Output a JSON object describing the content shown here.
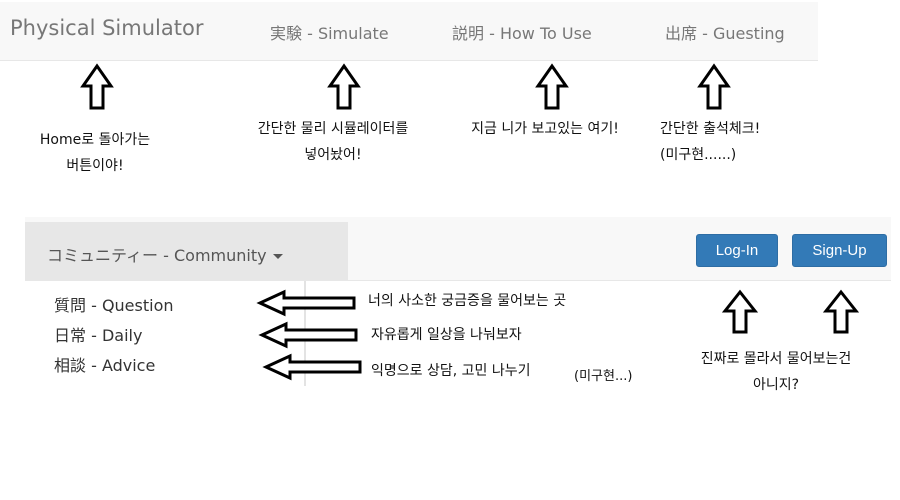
{
  "top_nav": {
    "brand": "Physical Simulator",
    "links": [
      {
        "label": "実験 - Simulate"
      },
      {
        "label": "説明 - How To Use"
      },
      {
        "label": "出席 - Guesting"
      }
    ]
  },
  "annotations_top": {
    "home": [
      "Home로 돌아가는",
      "버튼이야!"
    ],
    "simulate": [
      "간단한 물리 시뮬레이터를",
      "넣어놨어!"
    ],
    "how_to_use": [
      "지금 니가 보고있는 여기!"
    ],
    "guesting": [
      "간단한 출석체크!",
      "(미구현......)"
    ]
  },
  "bottom_nav": {
    "dropdown_label": "コミュニティー - Community",
    "login_label": "Log-In",
    "signup_label": "Sign-Up",
    "menu_items": [
      {
        "label": "質問 - Question"
      },
      {
        "label": "日常 - Daily"
      },
      {
        "label": "相談 - Advice"
      }
    ]
  },
  "annotations_bottom": {
    "question": "너의 사소한 궁금증을 물어보는 곳",
    "daily": "자유롭게 일상을 나눠보자",
    "advice": "익명으로 상담, 고민 나누기",
    "advice_note": "(미구현...)",
    "auth": [
      "진짜로 몰라서 물어보는건",
      "아니지?"
    ]
  },
  "colors": {
    "navbar_bg": "#f8f8f8",
    "dropdown_active_bg": "#e7e7e7",
    "button_primary": "#337ab7",
    "link_text": "#777777"
  }
}
